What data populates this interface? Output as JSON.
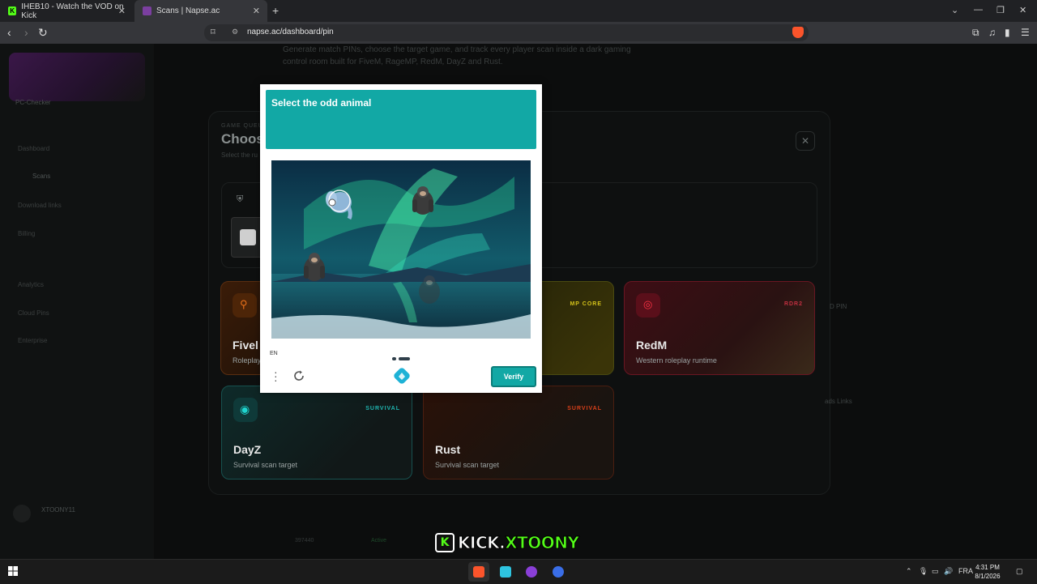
{
  "browser": {
    "tabs": [
      {
        "label": "IHEB10 - Watch the VOD on Kick",
        "icon": "kick-icon",
        "color": "#53fc18"
      },
      {
        "label": "Scans | Napse.ac",
        "icon": "napse-icon",
        "color": "#7b3fa0"
      }
    ],
    "url": "napse.ac/dashboard/pin"
  },
  "page": {
    "sidebar": {
      "top_label": "PC-Checker",
      "top_badge": "●  ...",
      "items": [
        "Dashboard",
        "Scans",
        "Download links",
        "Billing",
        "Analytics",
        "Cloud Pins",
        "Enterprise"
      ],
      "user": "XTOONY11"
    },
    "hero_text": "Generate match PINs, choose the target game, and track every player scan inside a dark gaming control room built for FiveM, RageMP, RedM, DayZ and Rust.",
    "panel": {
      "eyebrow": "GAME QUEUE",
      "title": "Choos",
      "subtitle": "Select the ru"
    },
    "cards": [
      {
        "name": "Fivel",
        "desc": "Roleplay",
        "tag": "",
        "color": "#e8701a"
      },
      {
        "name": "",
        "desc": "",
        "tag": "MP CORE",
        "color": "#d4c21a"
      },
      {
        "name": "RedM",
        "desc": "Western roleplay runtime",
        "tag": "RDR2",
        "color": "#e0263a"
      },
      {
        "name": "DayZ",
        "desc": "Survival scan target",
        "tag": "SURVIVAL",
        "color": "#1fb5b0"
      },
      {
        "name": "Rust",
        "desc": "Survival scan target",
        "tag": "SURVIVAL",
        "color": "#d8401a"
      }
    ],
    "right_labels": [
      "D PIN",
      "ads Links"
    ],
    "bottom_values": [
      "397440",
      "Active"
    ]
  },
  "captcha": {
    "prompt": "Select the odd animal",
    "language": "EN",
    "verify_label": "Verify",
    "accent": "#12a8a5"
  },
  "watermark": {
    "badge": "K",
    "text_a": "KICK.",
    "text_b": "XTOONY"
  },
  "taskbar": {
    "lang": "FRA",
    "time": "4:31 PM",
    "date": "8/1/2026"
  }
}
